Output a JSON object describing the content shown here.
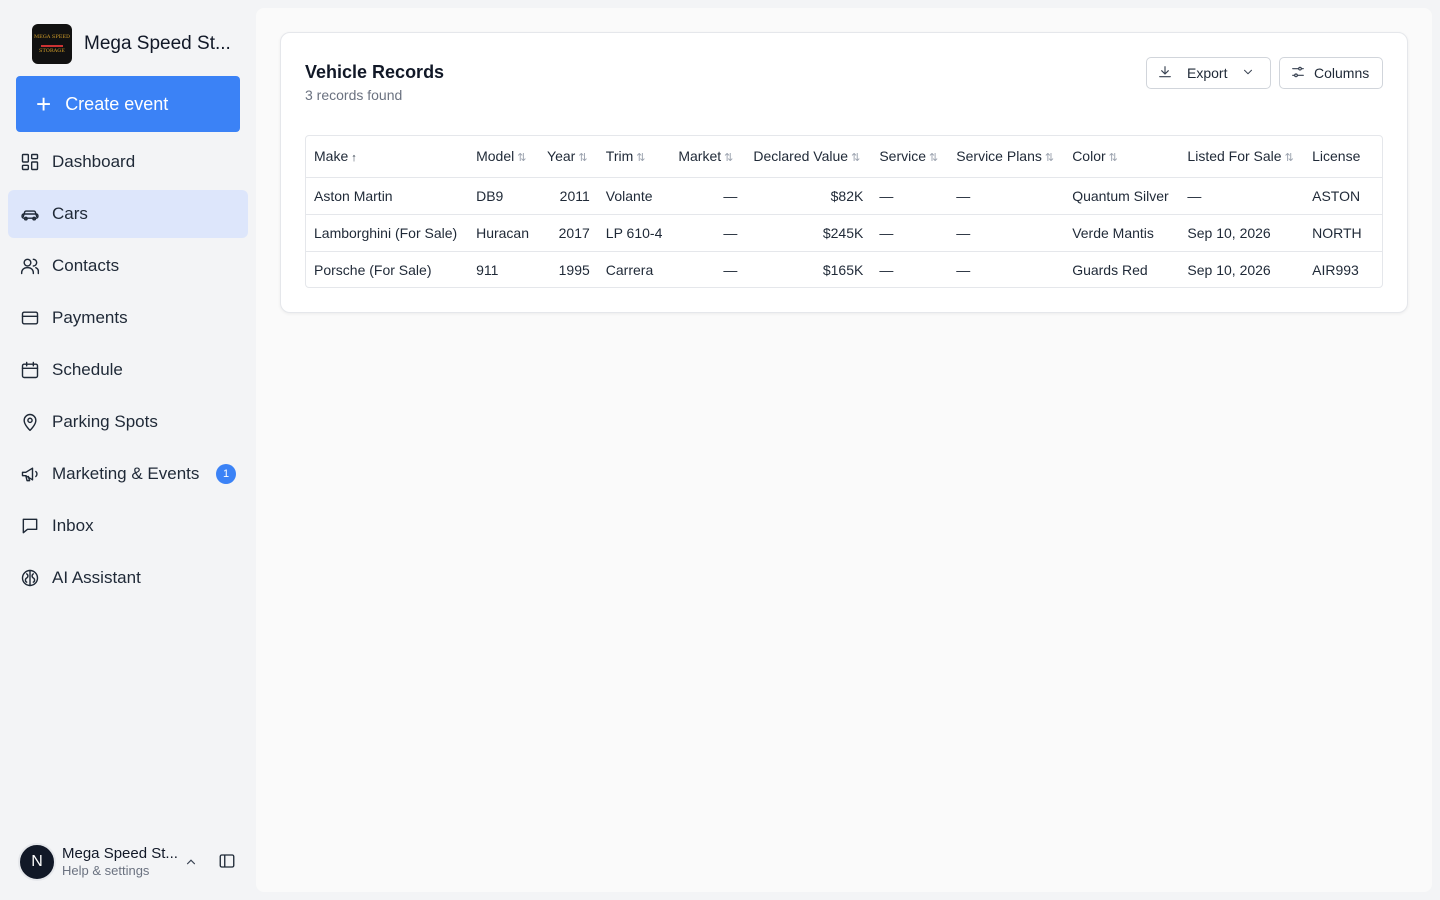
{
  "brand": {
    "name": "Mega Speed St...",
    "logo_text": [
      "MEGA SPEED",
      "STORAGE"
    ]
  },
  "sidebar": {
    "create_label": "Create event",
    "items": [
      {
        "label": "Dashboard",
        "icon": "dashboard-icon"
      },
      {
        "label": "Cars",
        "icon": "car-icon",
        "active": true
      },
      {
        "label": "Contacts",
        "icon": "users-icon"
      },
      {
        "label": "Payments",
        "icon": "credit-card-icon"
      },
      {
        "label": "Schedule",
        "icon": "calendar-icon"
      },
      {
        "label": "Parking Spots",
        "icon": "map-pin-icon"
      },
      {
        "label": "Marketing & Events",
        "icon": "megaphone-icon",
        "badge": "1"
      },
      {
        "label": "Inbox",
        "icon": "message-icon"
      },
      {
        "label": "AI Assistant",
        "icon": "brain-icon"
      }
    ]
  },
  "account": {
    "initial": "N",
    "name": "Mega Speed St...",
    "subtitle": "Help & settings"
  },
  "records": {
    "title": "Vehicle Records",
    "count_text": "3 records found",
    "export_label": "Export",
    "columns_label": "Columns",
    "headers": [
      "Make",
      "Model",
      "Year",
      "Trim",
      "Market",
      "Declared Value",
      "Service",
      "Service Plans",
      "Color",
      "Listed For Sale",
      "License"
    ],
    "rows": [
      [
        "Aston Martin",
        "DB9",
        "2011",
        "Volante",
        "—",
        "$82K",
        "—",
        "—",
        "Quantum Silver",
        "—",
        "ASTON"
      ],
      [
        "Lamborghini (For Sale)",
        "Huracan",
        "2017",
        "LP 610-4",
        "—",
        "$245K",
        "—",
        "—",
        "Verde Mantis",
        "Sep 10, 2026",
        "NORTH"
      ],
      [
        "Porsche (For Sale)",
        "911",
        "1995",
        "Carrera",
        "—",
        "$165K",
        "—",
        "—",
        "Guards Red",
        "Sep 10, 2026",
        "AIR993"
      ]
    ]
  },
  "colors": {
    "accent": "#3b82f6",
    "active_bg": "#dde6fb"
  }
}
